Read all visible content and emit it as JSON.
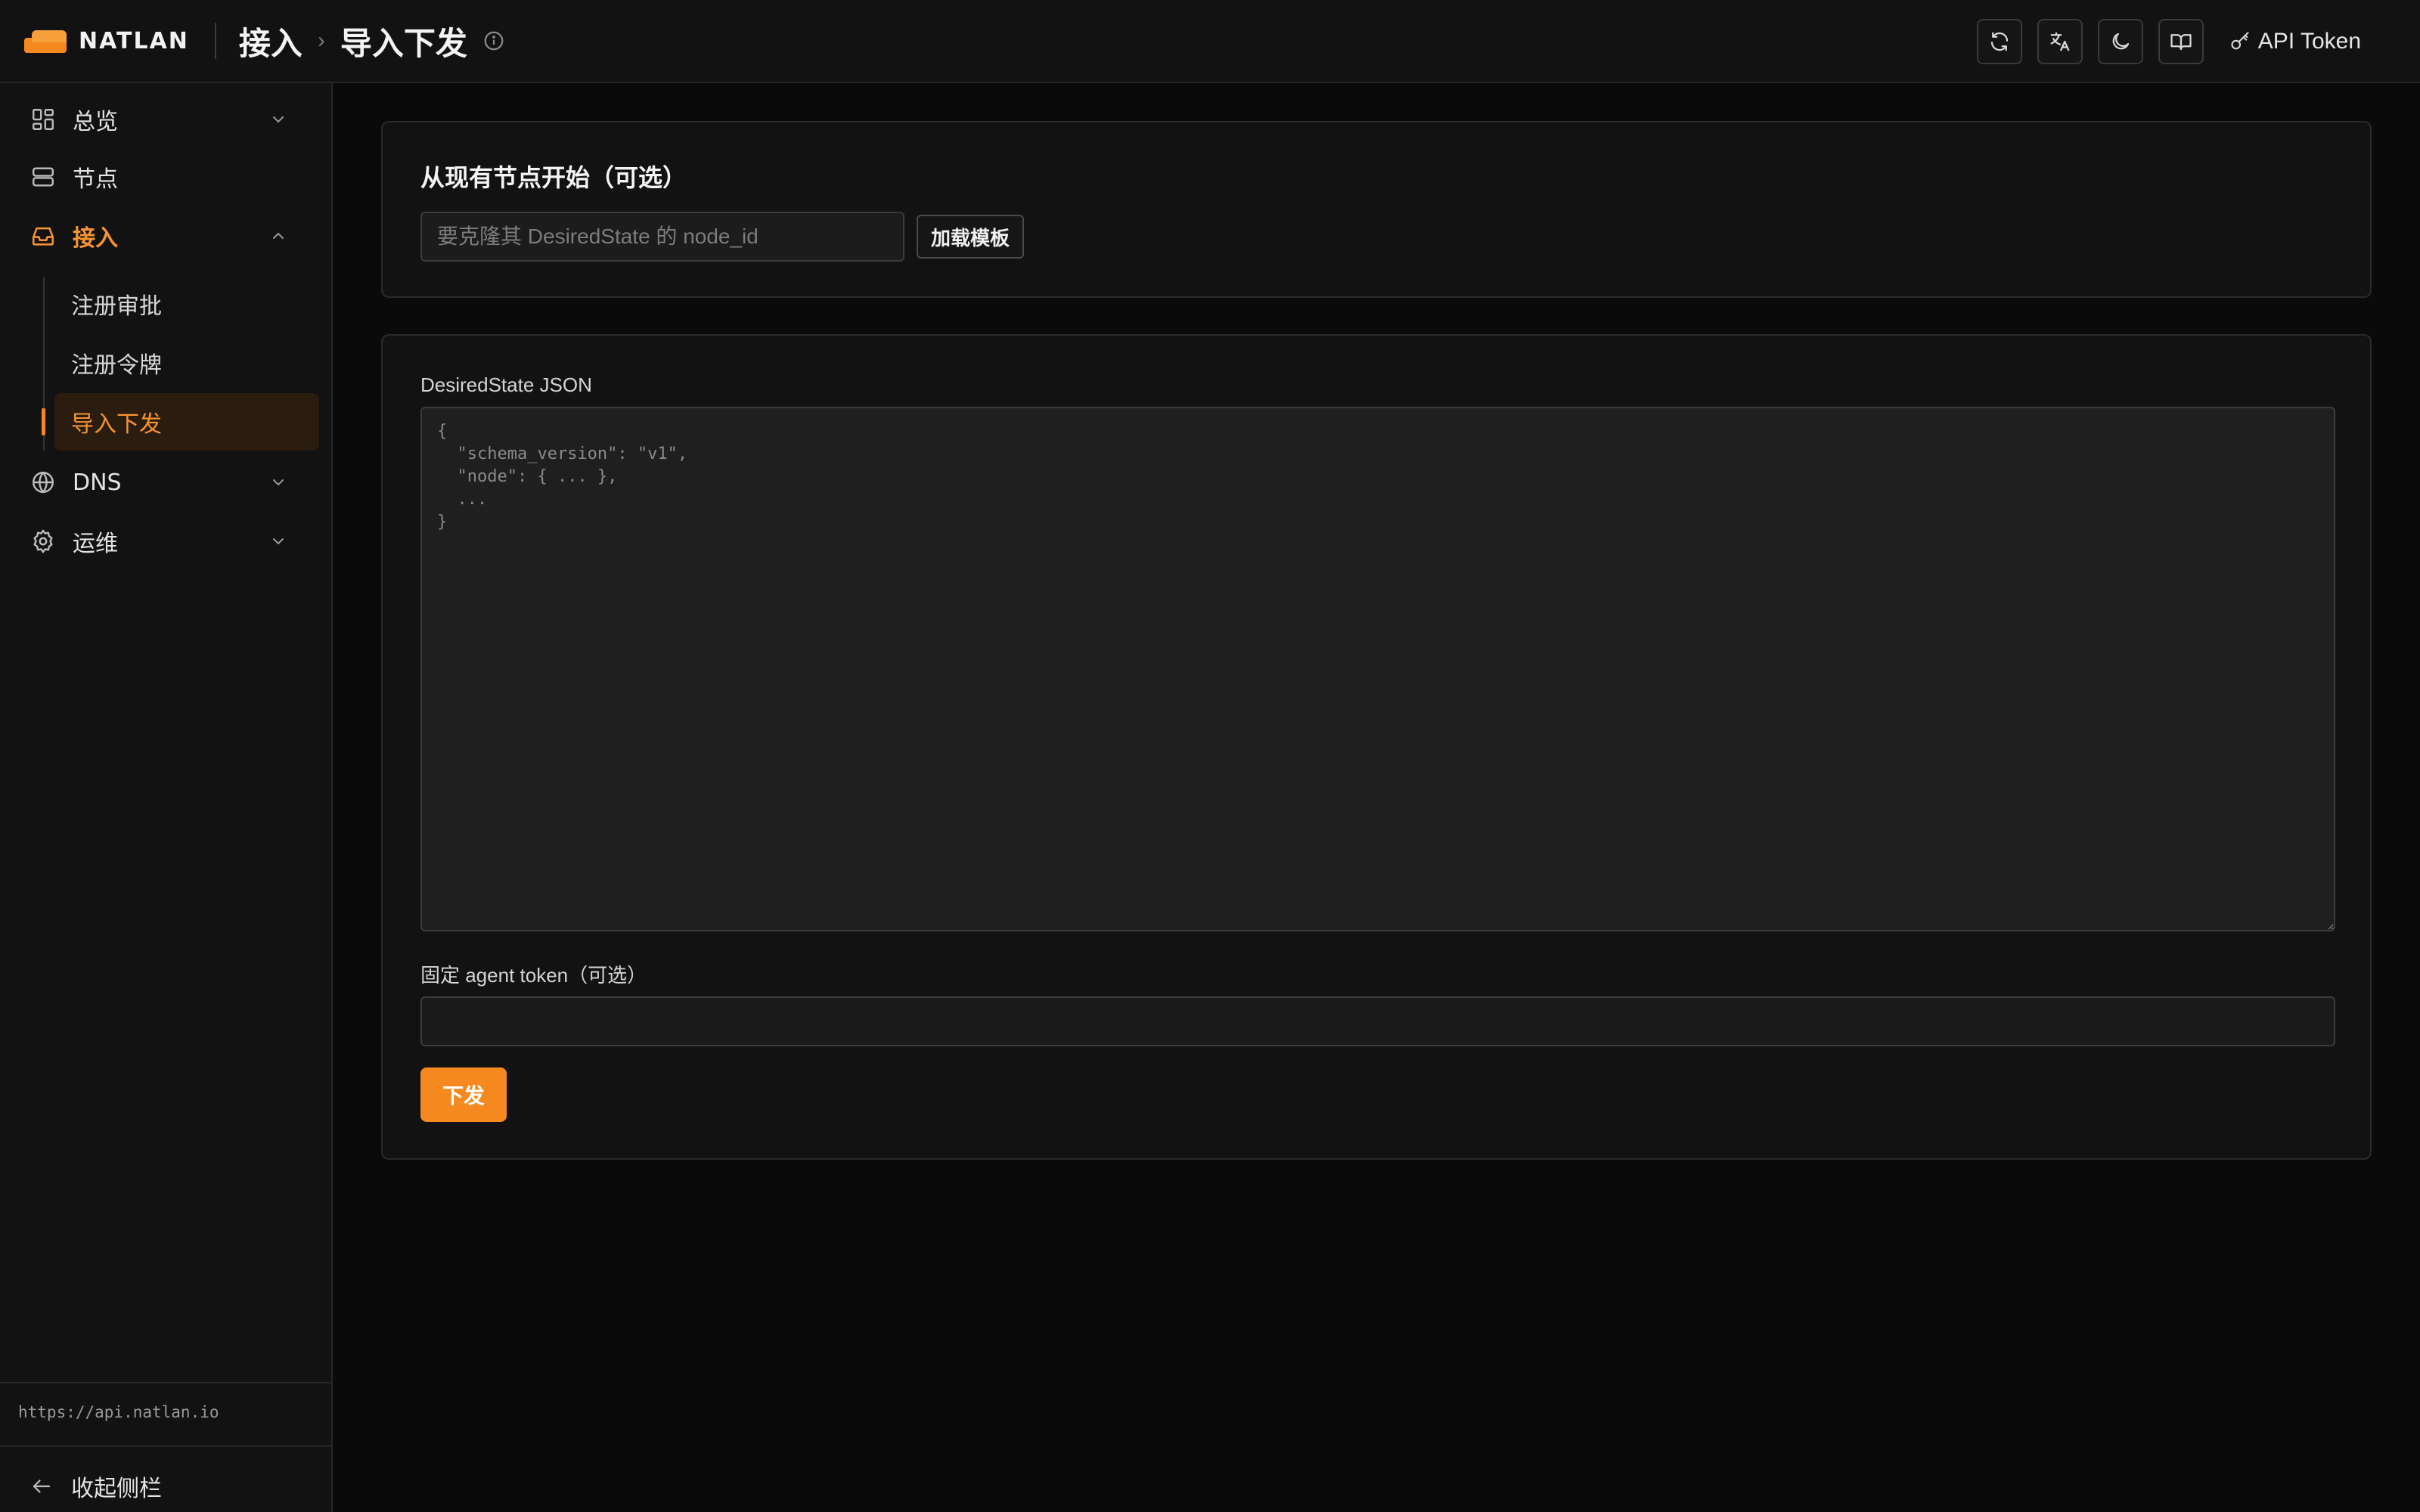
{
  "brand": {
    "name": "NATLAN",
    "logo_icon": "cloud-logo-icon",
    "accent": "#f5891f"
  },
  "breadcrumb": {
    "parent": "接入",
    "separator": "›",
    "current": "导入下发",
    "info_icon": "info-icon"
  },
  "toolbar": {
    "refresh_icon": "refresh-icon",
    "language_icon": "translate-icon",
    "theme_icon": "moon-icon",
    "docs_icon": "book-icon",
    "api_token_label": "API Token",
    "api_token_icon": "key-icon"
  },
  "sidebar": {
    "items": [
      {
        "label": "总览",
        "icon": "dashboard-icon",
        "expandable": true,
        "expanded": false
      },
      {
        "label": "节点",
        "icon": "server-icon",
        "expandable": false
      },
      {
        "label": "接入",
        "icon": "inbox-icon",
        "expandable": true,
        "expanded": true,
        "children": [
          {
            "label": "注册审批"
          },
          {
            "label": "注册令牌"
          },
          {
            "label": "导入下发",
            "active": true
          }
        ]
      },
      {
        "label": "DNS",
        "icon": "globe-icon",
        "expandable": true,
        "expanded": false
      },
      {
        "label": "运维",
        "icon": "gear-icon",
        "expandable": true,
        "expanded": false
      }
    ],
    "api_url": "https://api.natlan.io",
    "collapse_label": "收起侧栏",
    "collapse_icon": "arrow-left-icon"
  },
  "template_card": {
    "title": "从现有节点开始（可选）",
    "node_input_placeholder": "要克隆其 DesiredState 的 node_id",
    "node_input_value": "",
    "load_button_label": "加载模板"
  },
  "deploy_card": {
    "json_label": "DesiredState JSON",
    "json_placeholder": "{\n  \"schema_version\": \"v1\",\n  \"node\": { ... },\n  ...\n}",
    "json_value": "",
    "token_label": "固定 agent token（可选）",
    "token_value": "",
    "submit_label": "下发"
  }
}
